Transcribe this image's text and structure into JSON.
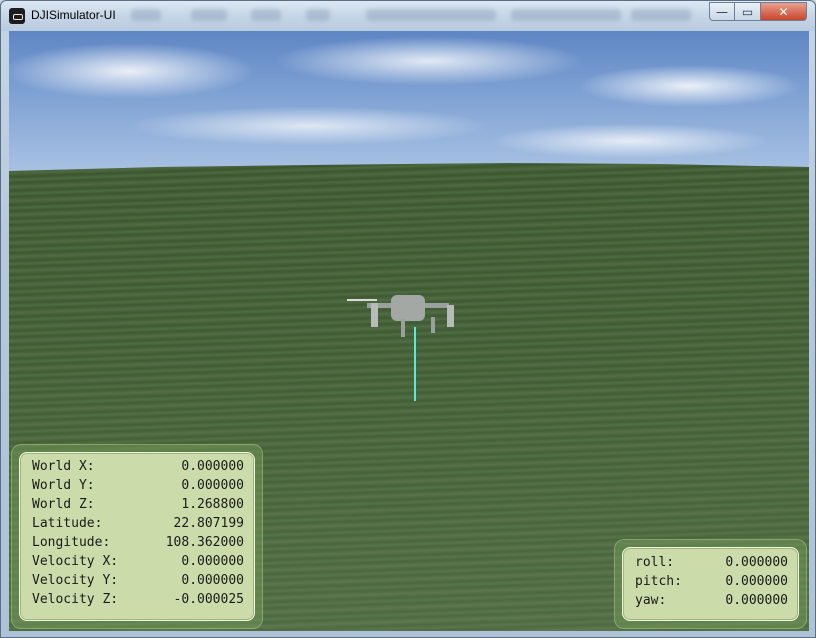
{
  "window": {
    "title": "DJISimulator-UI"
  },
  "controls": {
    "minimize_glyph": "—",
    "maximize_glyph": "▭",
    "close_glyph": "✕"
  },
  "position_panel": {
    "rows": [
      {
        "label": "World X:",
        "value": "0.000000"
      },
      {
        "label": "World Y:",
        "value": "0.000000"
      },
      {
        "label": "World Z:",
        "value": "1.268800"
      },
      {
        "label": "Latitude:",
        "value": "22.807199"
      },
      {
        "label": "Longitude:",
        "value": "108.362000"
      },
      {
        "label": "Velocity X:",
        "value": "0.000000"
      },
      {
        "label": "Velocity Y:",
        "value": "0.000000"
      },
      {
        "label": "Velocity Z:",
        "value": "-0.000025"
      }
    ]
  },
  "attitude_panel": {
    "rows": [
      {
        "label": "roll:",
        "value": "0.000000"
      },
      {
        "label": "pitch:",
        "value": "0.000000"
      },
      {
        "label": "yaw:",
        "value": "0.000000"
      }
    ]
  },
  "colors": {
    "ground": "#3e5a32",
    "sky": "#7fa2d4",
    "hud_panel": "#cbdcaa",
    "tether": "#61e7d8"
  }
}
